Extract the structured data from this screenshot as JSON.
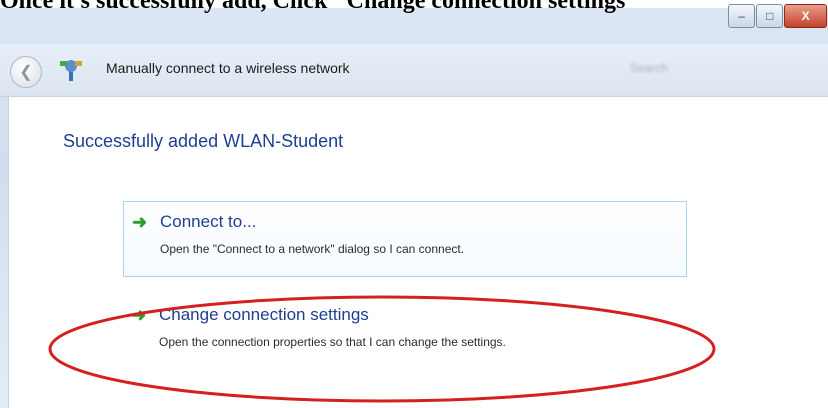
{
  "caption": "Once it's successfully add, Click \"Change connection settings\"",
  "nav": {
    "title": "Manually connect to a wireless network",
    "search_text": "Search"
  },
  "window_controls": {
    "minimize": "–",
    "maximize": "□",
    "close": "X"
  },
  "content": {
    "heading": "Successfully added WLAN-Student",
    "options": [
      {
        "title": "Connect to...",
        "description": "Open the \"Connect to a network\" dialog so I can connect."
      },
      {
        "title": "Change connection settings",
        "description": "Open the connection properties so that I can change the settings."
      }
    ]
  },
  "colors": {
    "accent": "#1e3f91",
    "arrow": "#2e9b2e",
    "highlight": "#d42020"
  },
  "icons": {
    "back": "back-arrow-icon",
    "network": "wireless-network-icon",
    "option": "green-arrow-icon"
  }
}
